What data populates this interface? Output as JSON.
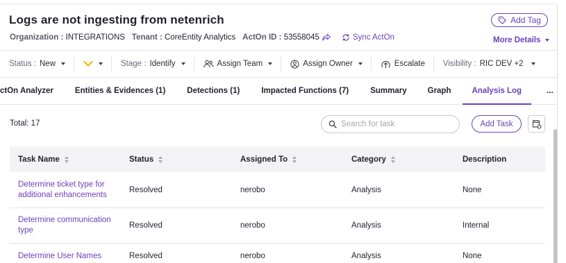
{
  "header": {
    "title": "Logs are not ingesting from netenrich",
    "add_tag_label": "Add Tag",
    "organization_label": "Organization :",
    "organization_value": "INTEGRATIONS",
    "tenant_label": "Tenant :",
    "tenant_value": "CoreEntity Analytics",
    "acton_label": "ActOn ID :",
    "acton_value": "53558045",
    "sync_label": "Sync ActOn",
    "more_details_label": "More Details"
  },
  "toolbar": {
    "status_label": "Status :",
    "status_value": "New",
    "stage_label": "Stage :",
    "stage_value": "Identify",
    "assign_team_label": "Assign Team",
    "assign_owner_label": "Assign Owner",
    "escalate_label": "Escalate",
    "visibility_label": "Visibility :",
    "visibility_value": "RIC DEV +2"
  },
  "tabs": [
    {
      "label": "ctOn Analyzer"
    },
    {
      "label": "Entities & Evidences (1)"
    },
    {
      "label": "Detections (1)"
    },
    {
      "label": "Impacted Functions (7)"
    },
    {
      "label": "Summary"
    },
    {
      "label": "Graph"
    },
    {
      "label": "Analysis Log"
    },
    {
      "label": "..."
    }
  ],
  "active_tab": "Analysis Log",
  "tasks": {
    "total_label": "Total: 17",
    "search_placeholder": "Search for task",
    "add_task_label": "Add Task",
    "columns": [
      "Task Name",
      "Status",
      "Assigned To",
      "Category",
      "Description"
    ],
    "rows": [
      {
        "name": "Determine ticket type for additional enhancements",
        "status": "Resolved",
        "assigned": "nerobo",
        "category": "Analysis",
        "description": "None"
      },
      {
        "name": "Determine communication type",
        "status": "Resolved",
        "assigned": "nerobo",
        "category": "Analysis",
        "description": "Internal"
      },
      {
        "name": "Determine User Names",
        "status": "Resolved",
        "assigned": "nerobo",
        "category": "Analysis",
        "description": "None"
      }
    ]
  },
  "colors": {
    "accent": "#6b3fbd",
    "priority_chevron": "#f2b705",
    "header_bg": "#f3f3f6"
  }
}
